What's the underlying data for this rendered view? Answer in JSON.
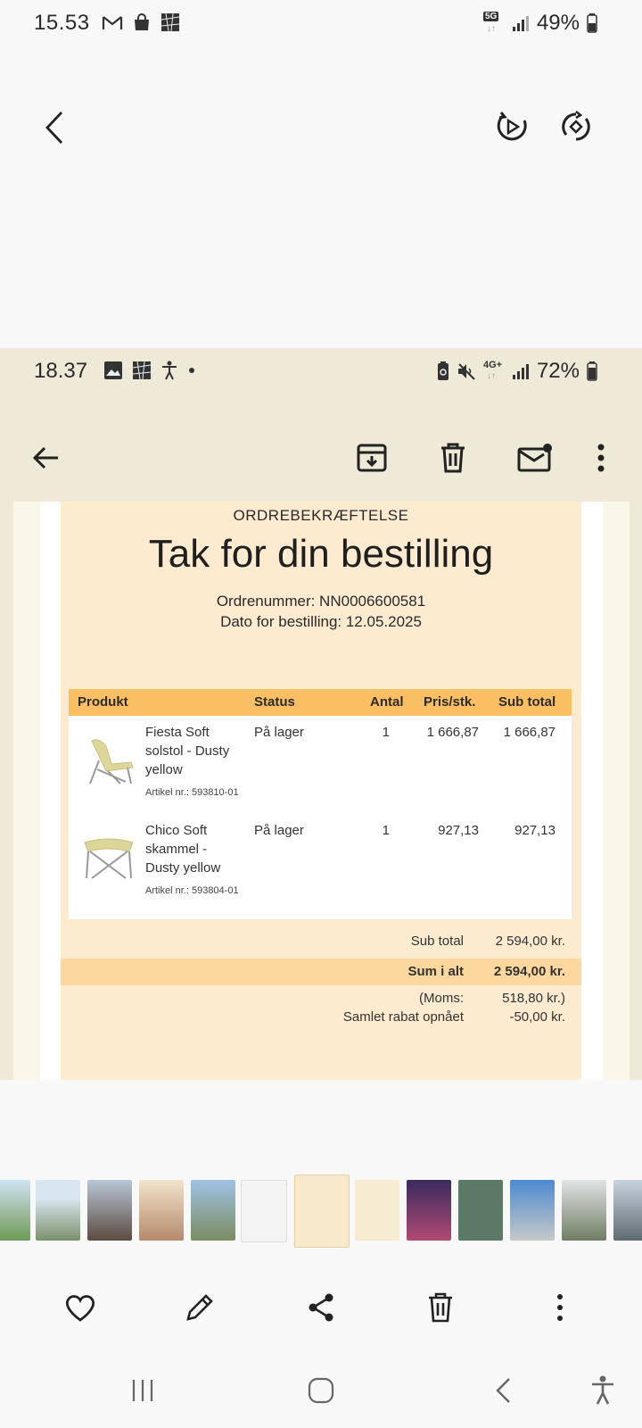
{
  "outer_status": {
    "time": "15.53",
    "network": "5G",
    "battery": "49%"
  },
  "embedded": {
    "status": {
      "time": "18.37",
      "network": "4G+",
      "battery": "72%"
    },
    "email": {
      "kicker": "ORDREBEKRÆFTELSE",
      "headline": "Tak for din bestilling",
      "order_number": "Ordrenummer: NN0006600581",
      "order_date": "Dato for bestilling: 12.05.2025",
      "table": {
        "headers": {
          "product": "Produkt",
          "status": "Status",
          "qty": "Antal",
          "price": "Pris/stk.",
          "subtotal": "Sub total"
        },
        "rows": [
          {
            "name": "Fiesta Soft solstol - Dusty yellow",
            "article": "Artikel nr.: 593810-01",
            "status": "På lager",
            "qty": "1",
            "price": "1 666,87",
            "subtotal": "1 666,87"
          },
          {
            "name": "Chico Soft skammel - Dusty yellow",
            "article": "Artikel nr.: 593804-01",
            "status": "På lager",
            "qty": "1",
            "price": "927,13",
            "subtotal": "927,13"
          }
        ]
      },
      "totals": {
        "subtotal_label": "Sub total",
        "subtotal_value": "2 594,00 kr.",
        "sum_label": "Sum i alt",
        "sum_value": "2 594,00 kr.",
        "vat_label": "(Moms:",
        "vat_value": "518,80 kr.)",
        "discount_label": "Samlet rabat opnået",
        "discount_value": "-50,00 kr."
      }
    }
  },
  "colors": {
    "accent_header": "#fbbf63",
    "email_bg": "#fdebd0",
    "total_band": "#fcd79e",
    "frame_bg": "#efe9d8"
  },
  "icons": [
    "back-icon",
    "motion-photo-icon",
    "rotate-icon",
    "archive-icon",
    "trash-icon",
    "mark-unread-icon",
    "more-icon",
    "heart-icon",
    "edit-icon",
    "share-icon",
    "delete-icon",
    "more-vert-icon",
    "recents-icon",
    "home-icon",
    "nav-back-icon",
    "accessibility-icon"
  ]
}
